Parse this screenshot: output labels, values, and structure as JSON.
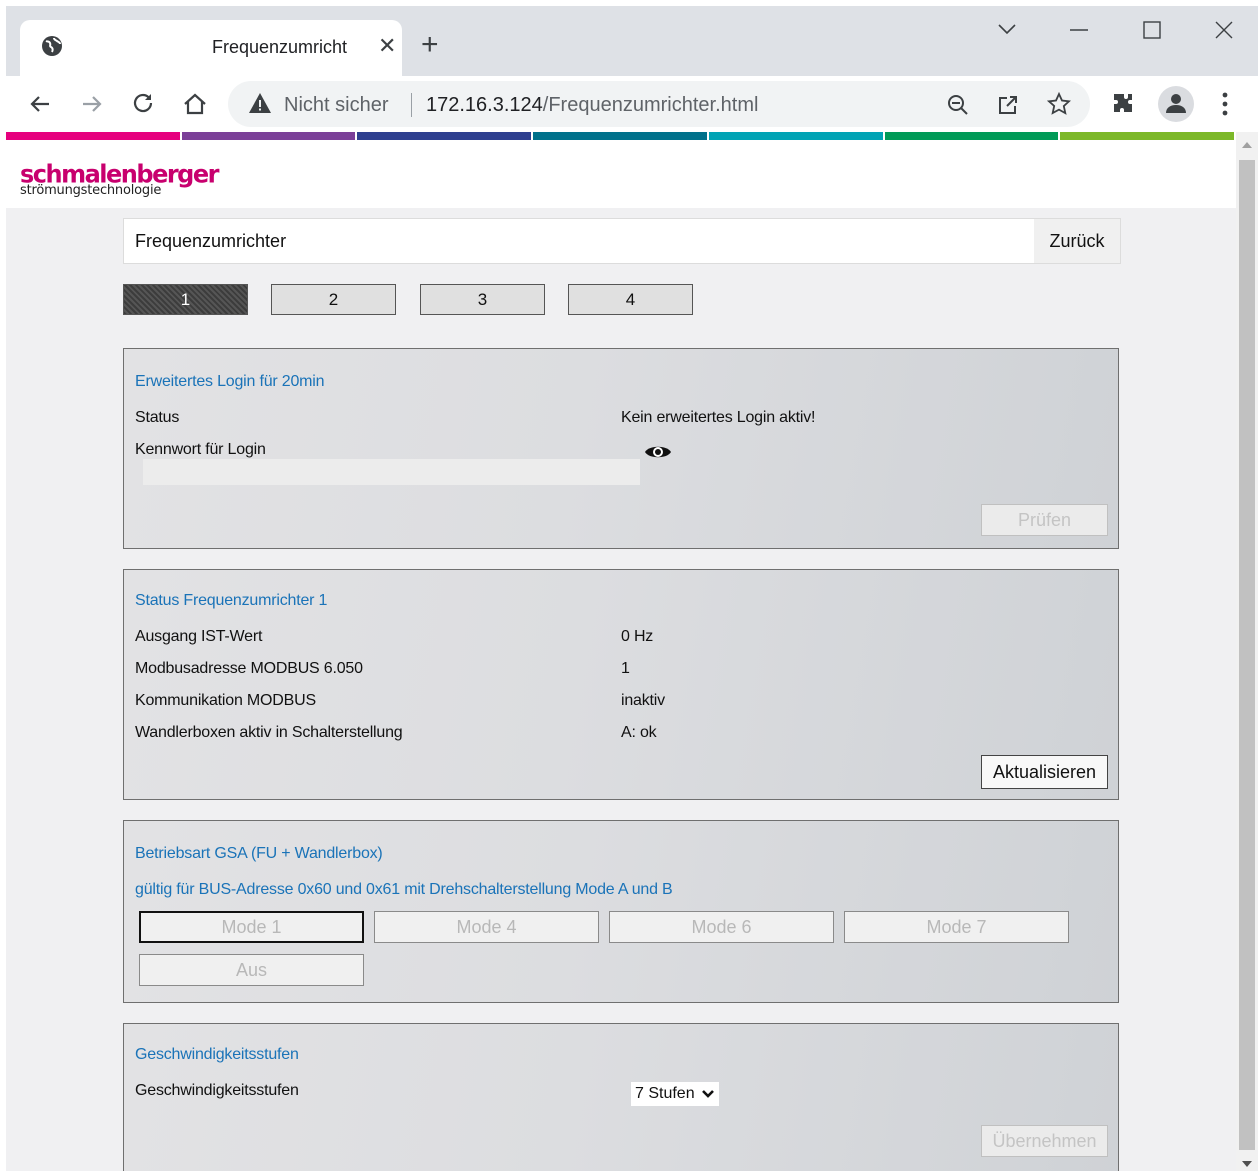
{
  "browser": {
    "tab_title": "Frequenzumricht",
    "security_label": "Nicht sicher",
    "url_host": "172.16.3.124",
    "url_path": "/Frequenzumrichter.html"
  },
  "logo": {
    "brand": "schmalenberger",
    "tagline": "strömungstechnologie"
  },
  "colors": {
    "stripe": [
      "#e6007e",
      "#7b3f98",
      "#2e3f8f",
      "#00718b",
      "#00a3b4",
      "#009a57",
      "#7cb829"
    ],
    "panel_title": "#1a73b8"
  },
  "header": {
    "title": "Frequenzumrichter",
    "back_label": "Zurück"
  },
  "tabs": [
    "1",
    "2",
    "3",
    "4"
  ],
  "login_panel": {
    "title": "Erweitertes Login für 20min",
    "status_label": "Status",
    "status_value": "Kein erweitertes Login aktiv!",
    "password_label": "Kennwort für Login",
    "password_value": "",
    "check_button": "Prüfen"
  },
  "status_panel": {
    "title": "Status Frequenzumrichter 1",
    "rows": [
      {
        "label": "Ausgang IST-Wert",
        "value": "0 Hz"
      },
      {
        "label": "Modbusadresse MODBUS 6.050",
        "value": "1"
      },
      {
        "label": "Kommunikation MODBUS",
        "value": "inaktiv"
      },
      {
        "label": "Wandlerboxen aktiv in Schalterstellung",
        "value": "A: ok"
      }
    ],
    "refresh_button": "Aktualisieren"
  },
  "mode_panel": {
    "title": "Betriebsart GSA (FU + Wandlerbox)",
    "subtitle": "gültig für BUS-Adresse 0x60 und 0x61 mit Drehschalterstellung Mode A und B",
    "modes": [
      "Mode 1",
      "Mode 4",
      "Mode 6",
      "Mode 7",
      "Aus"
    ],
    "selected_mode": "Mode 1"
  },
  "speed_panel": {
    "title": "Geschwindigkeitsstufen",
    "label": "Geschwindigkeitsstufen",
    "selected": "7 Stufen",
    "apply_button": "Übernehmen"
  }
}
